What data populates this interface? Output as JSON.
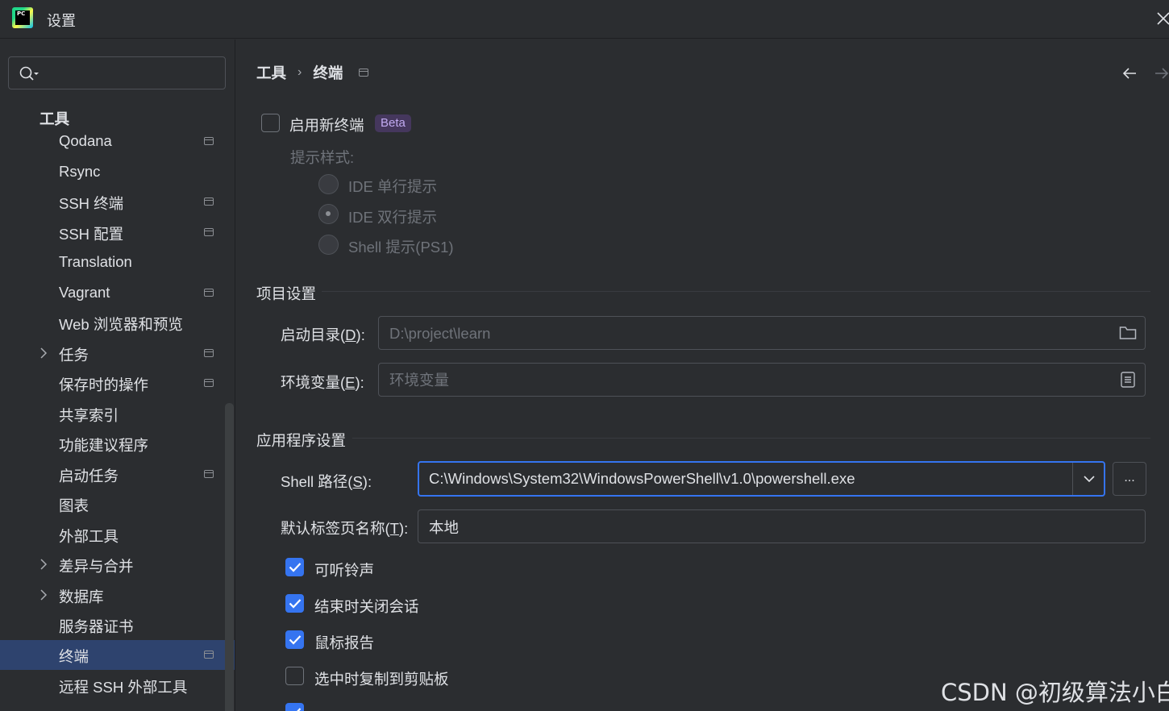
{
  "window": {
    "title": "设置",
    "logo_text": "PC"
  },
  "search": {
    "placeholder": ""
  },
  "sidebar": {
    "section": "工具",
    "items": [
      {
        "label": "Qodana",
        "pinned": true
      },
      {
        "label": "Rsync",
        "pinned": false
      },
      {
        "label": "SSH 终端",
        "pinned": true
      },
      {
        "label": "SSH 配置",
        "pinned": true
      },
      {
        "label": "Translation",
        "pinned": false
      },
      {
        "label": "Vagrant",
        "pinned": true
      },
      {
        "label": "Web 浏览器和预览",
        "pinned": false
      },
      {
        "label": "任务",
        "pinned": true,
        "expandable": true
      },
      {
        "label": "保存时的操作",
        "pinned": true
      },
      {
        "label": "共享索引",
        "pinned": false
      },
      {
        "label": "功能建议程序",
        "pinned": false
      },
      {
        "label": "启动任务",
        "pinned": true
      },
      {
        "label": "图表",
        "pinned": false
      },
      {
        "label": "外部工具",
        "pinned": false
      },
      {
        "label": "差异与合并",
        "pinned": false,
        "expandable": true
      },
      {
        "label": "数据库",
        "pinned": false,
        "expandable": true
      },
      {
        "label": "服务器证书",
        "pinned": false
      },
      {
        "label": "终端",
        "pinned": true,
        "selected": true
      },
      {
        "label": "远程 SSH 外部工具",
        "pinned": false
      }
    ]
  },
  "breadcrumb": {
    "parent": "工具",
    "separator": "›",
    "current": "终端"
  },
  "new_terminal": {
    "label": "启用新终端",
    "checked": false,
    "badge": "Beta",
    "prompt_style_label": "提示样式:",
    "options": [
      "IDE 单行提示",
      "IDE 双行提示",
      "Shell 提示(PS1)"
    ],
    "selected_option": 1
  },
  "project_settings": {
    "title": "项目设置",
    "start_dir_label": "启动目录(D):",
    "start_dir_label_pre": "启动目录(",
    "start_dir_label_key": "D",
    "start_dir_label_post": "):",
    "start_dir_placeholder": "D:\\project\\learn",
    "env_label_pre": "环境变量(",
    "env_label_key": "E",
    "env_label_post": "):",
    "env_placeholder": "环境变量"
  },
  "app_settings": {
    "title": "应用程序设置",
    "shell_label_pre": "Shell 路径(",
    "shell_label_key": "S",
    "shell_label_post": "):",
    "shell_path": "C:\\Windows\\System32\\WindowsPowerShell\\v1.0\\powershell.exe",
    "browse_label": "...",
    "tab_name_label_pre": "默认标签页名称(",
    "tab_name_label_key": "T",
    "tab_name_label_post": "):",
    "tab_name_value": "本地",
    "checkboxes": [
      {
        "label": "可听铃声",
        "checked": true
      },
      {
        "label": "结束时关闭会话",
        "checked": true
      },
      {
        "label": "鼠标报告",
        "checked": true
      },
      {
        "label": "选中时复制到剪贴板",
        "checked": false
      }
    ]
  },
  "watermark": "CSDN @初级算法小白",
  "colors": {
    "accent": "#3574f0",
    "background": "#2b2d30",
    "selection": "#2e436e",
    "beta_bg": "#45375d"
  }
}
